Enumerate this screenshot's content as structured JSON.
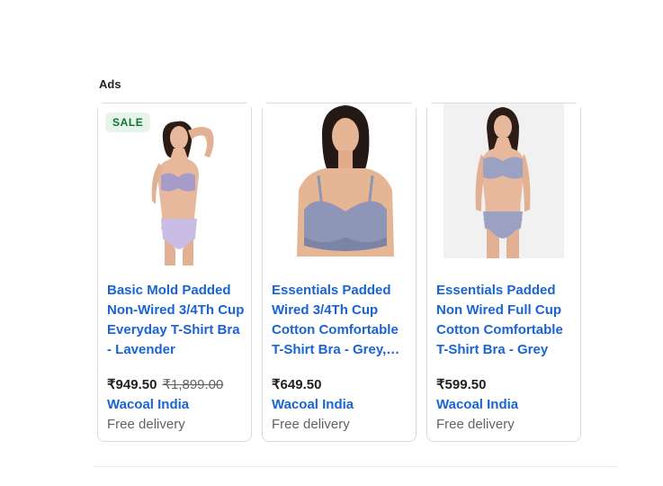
{
  "section_label": "Ads",
  "products": [
    {
      "badge": "SALE",
      "title": "Basic Mold Padded Non-Wired 3/4Th Cup Everyday T-Shirt Bra - Lavender",
      "price": "₹949.50",
      "old_price": "₹1,899.00",
      "merchant": "Wacoal India",
      "delivery": "Free delivery",
      "image": "model-lavender-bra-set"
    },
    {
      "title": "Essentials Padded Wired 3/4Th Cup Cotton Comfortable T-Shirt Bra - Grey, Blue",
      "price": "₹649.50",
      "merchant": "Wacoal India",
      "delivery": "Free delivery",
      "image": "model-grey-bra-closeup"
    },
    {
      "title": "Essentials Padded Non Wired Full Cup Cotton Comfortable T-Shirt Bra - Grey",
      "price": "₹599.50",
      "merchant": "Wacoal India",
      "delivery": "Free delivery",
      "image": "model-grey-bra-set"
    }
  ]
}
